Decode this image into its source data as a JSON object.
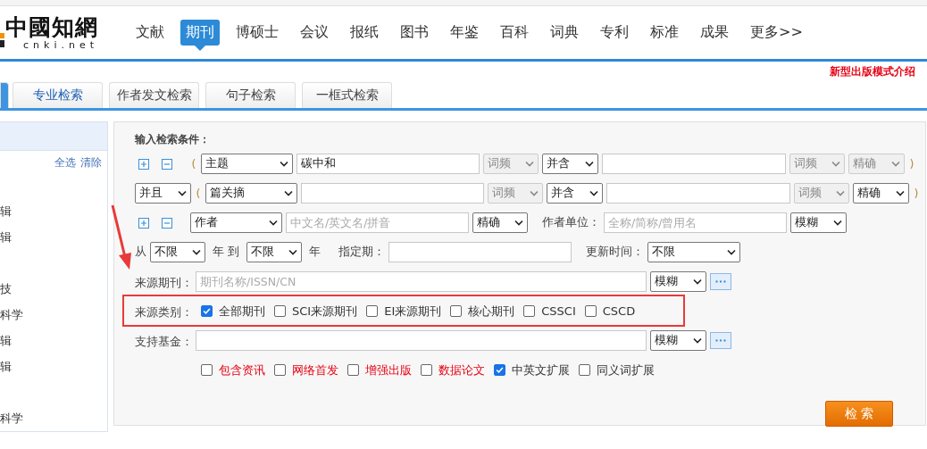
{
  "logo": {
    "title": "中國知網",
    "subtitle": "cnki.net"
  },
  "nav": [
    {
      "label": "文献",
      "selected": false
    },
    {
      "label": "期刊",
      "selected": true
    },
    {
      "label": "博硕士",
      "selected": false
    },
    {
      "label": "会议",
      "selected": false
    },
    {
      "label": "报纸",
      "selected": false
    },
    {
      "label": "图书",
      "selected": false
    },
    {
      "label": "年鉴",
      "selected": false
    },
    {
      "label": "百科",
      "selected": false
    },
    {
      "label": "词典",
      "selected": false
    },
    {
      "label": "专利",
      "selected": false
    },
    {
      "label": "标准",
      "selected": false
    },
    {
      "label": "成果",
      "selected": false
    },
    {
      "label": "更多>>",
      "selected": false
    }
  ],
  "promo_link": "新型出版模式介绍",
  "search_tabs": [
    {
      "selected": true
    },
    {
      "label": "专业检索",
      "selected": false,
      "hover": true
    },
    {
      "label": "作者发文检索",
      "selected": false,
      "hover": false
    },
    {
      "label": "句子检索",
      "selected": false,
      "hover": false
    },
    {
      "label": "一框式检索",
      "selected": false,
      "hover": false
    }
  ],
  "sidebar": {
    "select_all": "全选",
    "clear": "清除",
    "groups": [
      {
        "items": [
          "辑",
          "辑"
        ]
      },
      {
        "items": [
          "技",
          "科学",
          "辑",
          "辑"
        ]
      },
      {
        "items": [
          "科学"
        ]
      }
    ]
  },
  "form": {
    "heading": "输入检索条件：",
    "rows": [
      {
        "kind": "condition",
        "add_remove": true,
        "open_paren": "(",
        "field": {
          "value": "主题",
          "disabled": false
        },
        "term": "碳中和",
        "frequency": {
          "value": "词频",
          "disabled": true
        },
        "logic": {
          "value": "并含",
          "disabled": false
        },
        "frequency2": {
          "value": "词频",
          "disabled": true
        },
        "match": {
          "value": "精确",
          "disabled": true
        },
        "close_paren": ")"
      },
      {
        "kind": "condition",
        "add_remove": false,
        "boolean": {
          "value": "并且",
          "disabled": false
        },
        "open_paren": "(",
        "field": {
          "value": "篇关摘",
          "disabled": false
        },
        "frequency": {
          "value": "词频",
          "disabled": true
        },
        "logic": {
          "value": "并含",
          "disabled": false
        },
        "frequency2": {
          "value": "词频",
          "disabled": true
        },
        "match": {
          "value": "精确",
          "disabled": false
        },
        "close_paren": ")"
      },
      {
        "kind": "author",
        "add_remove": true,
        "field": {
          "value": "作者",
          "disabled": false
        },
        "author_placeholder": "中文名/英文名/拼音",
        "author_match": {
          "value": "精确",
          "disabled": false
        },
        "org_label": "作者单位：",
        "org_placeholder": "全称/简称/曾用名",
        "org_match": {
          "value": "模糊",
          "disabled": false
        }
      },
      {
        "kind": "time",
        "from_label": "从",
        "from_year": {
          "value": "不限",
          "disabled": false
        },
        "to_label": "年 到",
        "to_year": {
          "value": "不限",
          "disabled": false
        },
        "year_label": "年",
        "period_label": "指定期：",
        "update_label": "更新时间：",
        "update": {
          "value": "不限",
          "disabled": false
        }
      },
      {
        "kind": "source",
        "label": "来源期刊：",
        "placeholder": "期刊名称/ISSN/CN",
        "match": {
          "value": "模糊",
          "disabled": false
        }
      },
      {
        "kind": "checks",
        "label": "来源类别：",
        "items": [
          {
            "label": "全部期刊",
            "checked": true
          },
          {
            "label": "SCI来源期刊",
            "checked": false
          },
          {
            "label": "EI来源期刊",
            "checked": false
          },
          {
            "label": "核心期刊",
            "checked": false
          },
          {
            "label": "CSSCI",
            "checked": false
          },
          {
            "label": "CSCD",
            "checked": false
          }
        ]
      },
      {
        "kind": "source",
        "label": "支持基金：",
        "match": {
          "value": "模糊",
          "disabled": false
        }
      },
      {
        "kind": "checks",
        "items": [
          {
            "label": "包含资讯",
            "checked": false,
            "highlight": true
          },
          {
            "label": "网络首发",
            "checked": false,
            "highlight": true
          },
          {
            "label": "增强出版",
            "checked": false,
            "highlight": true
          },
          {
            "label": "数据论文",
            "checked": false,
            "highlight": true
          },
          {
            "label": "中英文扩展",
            "checked": true,
            "highlight": false
          },
          {
            "label": "同义词扩展",
            "checked": false,
            "highlight": false
          }
        ]
      }
    ],
    "search_button": "检 索"
  }
}
